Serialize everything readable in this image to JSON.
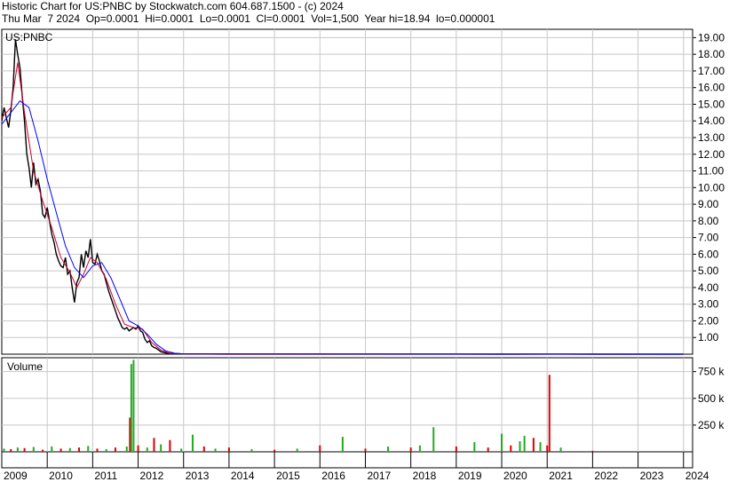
{
  "header": {
    "line1": "Historic Chart for US:PNBC by Stockwatch.com 604.687.1500 - (c) 2024",
    "line2": "Thu Mar  7 2024  Op=0.0001  Hi=0.0001  Lo=0.0001  Cl=0.0001  Vol=1,500  Year hi=18.94  lo=0.000001"
  },
  "colors": {
    "price": "#000000",
    "ma_short": "#cc0033",
    "ma_long": "#0000ff",
    "vol_up": "#22aa22",
    "vol_down": "#dd0000",
    "grid": "#c8c8c8"
  },
  "chart_data": [
    {
      "type": "line",
      "title": "US:PNBC",
      "ylim": [
        0,
        19.5
      ],
      "xlim": [
        2009.0,
        2024.2
      ],
      "grid": true,
      "y_ticks": [
        "1.00",
        "2.00",
        "3.00",
        "4.00",
        "5.00",
        "6.00",
        "7.00",
        "8.00",
        "9.00",
        "10.00",
        "11.00",
        "12.00",
        "13.00",
        "14.00",
        "15.00",
        "16.00",
        "17.00",
        "18.00",
        "19.00"
      ],
      "series": [
        {
          "key": "price",
          "x": [
            2009.0,
            2009.05,
            2009.1,
            2009.15,
            2009.2,
            2009.25,
            2009.3,
            2009.35,
            2009.4,
            2009.45,
            2009.5,
            2009.55,
            2009.6,
            2009.65,
            2009.7,
            2009.75,
            2009.8,
            2009.85,
            2009.9,
            2009.95,
            2010.0,
            2010.05,
            2010.1,
            2010.15,
            2010.2,
            2010.25,
            2010.3,
            2010.35,
            2010.4,
            2010.45,
            2010.5,
            2010.55,
            2010.6,
            2010.65,
            2010.7,
            2010.75,
            2010.8,
            2010.85,
            2010.9,
            2010.95,
            2011.0,
            2011.05,
            2011.1,
            2011.15,
            2011.2,
            2011.25,
            2011.3,
            2011.35,
            2011.4,
            2011.45,
            2011.5,
            2011.55,
            2011.6,
            2011.65,
            2011.7,
            2011.75,
            2011.8,
            2011.85,
            2011.9,
            2011.95,
            2012.0,
            2012.05,
            2012.1,
            2012.15,
            2012.2,
            2012.25,
            2012.3,
            2012.35,
            2012.4,
            2012.45,
            2012.5,
            2012.6,
            2012.7,
            2012.8,
            2012.9,
            2013.0,
            2013.5,
            2014.0,
            2015.0,
            2016.0,
            2017.0,
            2018.0,
            2019.0,
            2020.0,
            2021.0,
            2022.0,
            2023.0,
            2024.0
          ],
          "values": [
            14.0,
            14.8,
            14.2,
            13.6,
            14.6,
            16.0,
            18.9,
            18.0,
            17.2,
            15.5,
            14.0,
            12.0,
            11.2,
            10.0,
            11.5,
            10.2,
            10.5,
            9.8,
            8.4,
            8.2,
            8.8,
            8.0,
            7.2,
            6.7,
            6.0,
            5.6,
            5.3,
            5.2,
            5.8,
            4.8,
            5.0,
            4.0,
            3.1,
            4.3,
            4.6,
            6.0,
            5.2,
            6.2,
            5.8,
            6.9,
            5.5,
            5.4,
            6.0,
            5.6,
            5.0,
            4.8,
            4.3,
            3.8,
            3.4,
            3.0,
            2.6,
            2.2,
            1.9,
            1.6,
            1.5,
            1.6,
            1.4,
            1.5,
            1.6,
            1.5,
            1.7,
            1.4,
            1.3,
            0.9,
            0.7,
            0.8,
            0.5,
            0.4,
            0.35,
            0.25,
            0.15,
            0.08,
            0.05,
            0.03,
            0.02,
            0.01,
            0.01,
            0.005,
            0.005,
            0.004,
            0.004,
            0.003,
            0.003,
            0.002,
            0.003,
            0.002,
            0.001,
            0.0001
          ]
        },
        {
          "key": "ma_short",
          "x": [
            2009.0,
            2009.2,
            2009.35,
            2009.5,
            2009.7,
            2009.9,
            2010.1,
            2010.3,
            2010.5,
            2010.65,
            2010.8,
            2010.95,
            2011.1,
            2011.3,
            2011.5,
            2011.7,
            2011.9,
            2012.1,
            2012.3,
            2012.5,
            2012.7,
            2013.0,
            2024.0
          ],
          "values": [
            14.2,
            14.8,
            17.5,
            14.5,
            11.0,
            9.2,
            7.6,
            5.8,
            4.9,
            4.0,
            4.8,
            5.8,
            5.5,
            4.5,
            3.0,
            1.8,
            1.6,
            1.5,
            0.7,
            0.25,
            0.05,
            0.01,
            0.0
          ]
        },
        {
          "key": "ma_long",
          "x": [
            2009.0,
            2009.2,
            2009.4,
            2009.6,
            2009.8,
            2010.0,
            2010.2,
            2010.4,
            2010.6,
            2010.8,
            2011.0,
            2011.2,
            2011.4,
            2011.6,
            2011.8,
            2012.0,
            2012.2,
            2012.4,
            2012.6,
            2012.8,
            2013.0,
            2024.0
          ],
          "values": [
            13.8,
            14.5,
            15.2,
            14.8,
            12.8,
            10.5,
            8.5,
            6.5,
            5.2,
            4.6,
            5.3,
            5.5,
            4.6,
            3.3,
            2.0,
            1.7,
            1.2,
            0.6,
            0.2,
            0.06,
            0.02,
            0.0
          ]
        }
      ]
    },
    {
      "type": "bar",
      "title": "Volume",
      "ylim": [
        0,
        880
      ],
      "y_ticks": [
        "250 k",
        "500 k",
        "750 k"
      ],
      "x_ticks": [
        "2009",
        "2010",
        "2011",
        "2012",
        "2013",
        "2014",
        "2015",
        "2016",
        "2017",
        "2018",
        "2019",
        "2020",
        "2021",
        "2022",
        "2023",
        "2024"
      ],
      "units": "k",
      "x": [
        2009.05,
        2009.2,
        2009.35,
        2009.5,
        2009.7,
        2009.9,
        2010.1,
        2010.3,
        2010.5,
        2010.7,
        2010.9,
        2011.1,
        2011.3,
        2011.5,
        2011.75,
        2011.82,
        2011.85,
        2011.9,
        2012.0,
        2012.2,
        2012.35,
        2012.5,
        2012.7,
        2012.95,
        2013.2,
        2013.45,
        2013.7,
        2014.0,
        2014.5,
        2015.0,
        2015.5,
        2016.0,
        2016.5,
        2017.0,
        2017.5,
        2018.0,
        2018.2,
        2018.5,
        2019.0,
        2019.4,
        2019.7,
        2020.0,
        2020.2,
        2020.4,
        2020.5,
        2020.7,
        2020.85,
        2021.0,
        2021.05,
        2021.3,
        2022.0,
        2023.0
      ],
      "values": [
        30,
        25,
        40,
        35,
        45,
        20,
        50,
        30,
        35,
        40,
        55,
        30,
        25,
        40,
        50,
        320,
        820,
        860,
        60,
        40,
        130,
        70,
        110,
        30,
        160,
        50,
        30,
        40,
        25,
        20,
        30,
        60,
        140,
        30,
        50,
        40,
        60,
        230,
        50,
        90,
        40,
        170,
        60,
        100,
        150,
        130,
        90,
        60,
        720,
        40,
        10,
        5
      ],
      "up": [
        true,
        false,
        true,
        false,
        true,
        false,
        true,
        false,
        true,
        false,
        true,
        false,
        true,
        false,
        true,
        false,
        true,
        true,
        false,
        true,
        false,
        true,
        false,
        true,
        true,
        false,
        true,
        false,
        true,
        false,
        true,
        false,
        true,
        false,
        true,
        false,
        true,
        true,
        false,
        true,
        false,
        true,
        false,
        true,
        true,
        false,
        true,
        false,
        false,
        true,
        false,
        true
      ]
    }
  ]
}
